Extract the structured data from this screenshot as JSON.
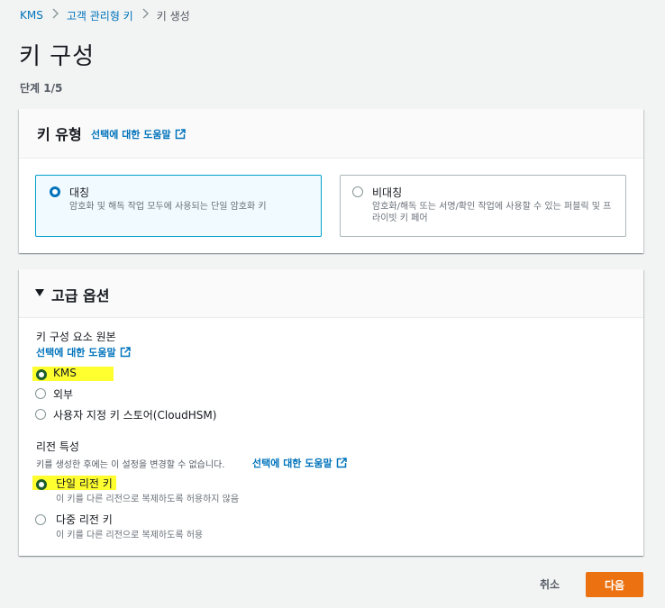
{
  "breadcrumb": {
    "items": [
      "KMS",
      "고객 관리형 키",
      "키 생성"
    ]
  },
  "page": {
    "title": "키 구성",
    "step": "단계 1/5"
  },
  "key_type": {
    "title": "키 유형",
    "info_link": "선택에 대한 도움말",
    "options": [
      {
        "label": "대칭",
        "description": "암호화 및 해독 작업 모두에 사용되는 단일 암호화 키",
        "selected": true
      },
      {
        "label": "비대칭",
        "description": "암호화/해독 또는 서명/확인 작업에 사용할 수 있는 퍼블릭 및 프라이빗 키 페어",
        "selected": false
      }
    ]
  },
  "advanced": {
    "title": "고급 옵션",
    "origin": {
      "label": "키 구성 요소 원본",
      "info_link": "선택에 대한 도움말",
      "options": [
        "KMS",
        "외부",
        "사용자 지정 키 스토어(CloudHSM)"
      ],
      "selected": "KMS"
    },
    "regionality": {
      "label": "리전 특성",
      "description": "키를 생성한 후에는 이 설정을 변경할 수 없습니다.",
      "info_link": "선택에 대한 도움말",
      "options": [
        {
          "label": "단일 리전 키",
          "description": "이 키를 다른 리전으로 복제하도록 허용하지 않음",
          "selected": true
        },
        {
          "label": "다중 리전 키",
          "description": "이 키를 다른 리전으로 복제하도록 허용",
          "selected": false
        }
      ]
    }
  },
  "actions": {
    "cancel": "취소",
    "next": "다음"
  },
  "colors": {
    "accent": "#0073bb",
    "primary_button": "#ec7211",
    "highlight": "#ffff30"
  }
}
